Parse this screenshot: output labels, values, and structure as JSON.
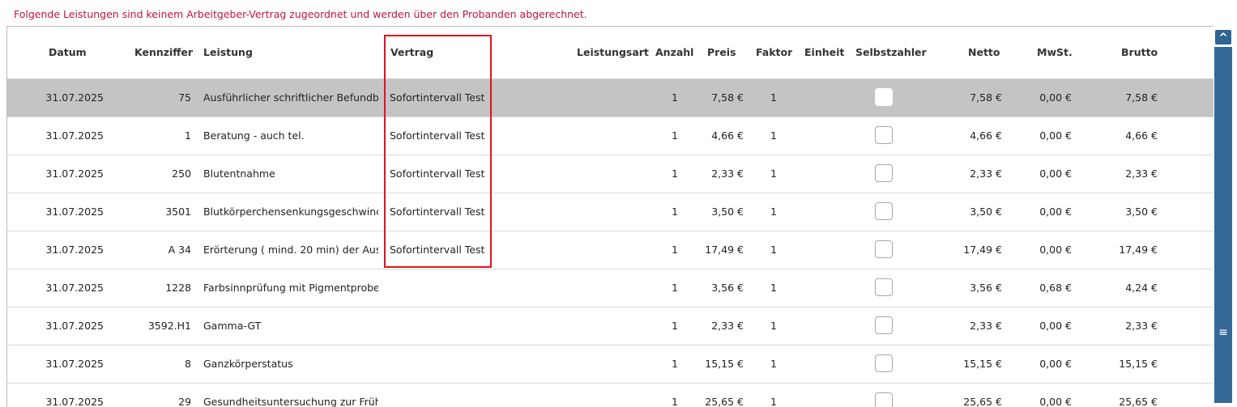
{
  "notice": "Folgende Leistungen sind keinem Arbeitgeber-Vertrag zugeordnet und werden über den Probanden abgerechnet.",
  "headers": {
    "datum": "Datum",
    "kennziffer": "Kennziffer",
    "leistung": "Leistung",
    "vertrag": "Vertrag",
    "leistungsart": "Leistungsart",
    "anzahl": "Anzahl",
    "preis": "Preis",
    "faktor": "Faktor",
    "einheit": "Einheit",
    "selbstzahler": "Selbstzahler",
    "netto": "Netto",
    "mwst": "MwSt.",
    "brutto": "Brutto"
  },
  "rows": [
    {
      "datum": "31.07.2025",
      "kennziffer": "75",
      "leistung": "Ausführlicher schriftlicher Befundbe",
      "vertrag": "Sofortintervall Test",
      "anzahl": "1",
      "preis": "7,58 €",
      "faktor": "1",
      "netto": "7,58 €",
      "mwst": "0,00 €",
      "brutto": "7,58 €",
      "selected": true
    },
    {
      "datum": "31.07.2025",
      "kennziffer": "1",
      "leistung": "Beratung - auch tel.",
      "vertrag": "Sofortintervall Test",
      "anzahl": "1",
      "preis": "4,66 €",
      "faktor": "1",
      "netto": "4,66 €",
      "mwst": "0,00 €",
      "brutto": "4,66 €"
    },
    {
      "datum": "31.07.2025",
      "kennziffer": "250",
      "leistung": "Blutentnahme",
      "vertrag": "Sofortintervall Test",
      "anzahl": "1",
      "preis": "2,33 €",
      "faktor": "1",
      "netto": "2,33 €",
      "mwst": "0,00 €",
      "brutto": "2,33 €"
    },
    {
      "datum": "31.07.2025",
      "kennziffer": "3501",
      "leistung": "Blutkörperchensenkungsgeschwinc",
      "vertrag": "Sofortintervall Test",
      "anzahl": "1",
      "preis": "3,50 €",
      "faktor": "1",
      "netto": "3,50 €",
      "mwst": "0,00 €",
      "brutto": "3,50 €"
    },
    {
      "datum": "31.07.2025",
      "kennziffer": "A 34",
      "leistung": "Erörterung ( mind. 20 min) der Aus",
      "vertrag": "Sofortintervall Test",
      "anzahl": "1",
      "preis": "17,49 €",
      "faktor": "1",
      "netto": "17,49 €",
      "mwst": "0,00 €",
      "brutto": "17,49 €"
    },
    {
      "datum": "31.07.2025",
      "kennziffer": "1228",
      "leistung": "Farbsinnprüfung mit Pigmentprobe",
      "vertrag": "",
      "anzahl": "1",
      "preis": "3,56 €",
      "faktor": "1",
      "netto": "3,56 €",
      "mwst": "0,68 €",
      "brutto": "4,24 €"
    },
    {
      "datum": "31.07.2025",
      "kennziffer": "3592.H1",
      "leistung": "Gamma-GT",
      "vertrag": "",
      "anzahl": "1",
      "preis": "2,33 €",
      "faktor": "1",
      "netto": "2,33 €",
      "mwst": "0,00 €",
      "brutto": "2,33 €"
    },
    {
      "datum": "31.07.2025",
      "kennziffer": "8",
      "leistung": "Ganzkörperstatus",
      "vertrag": "",
      "anzahl": "1",
      "preis": "15,15 €",
      "faktor": "1",
      "netto": "15,15 €",
      "mwst": "0,00 €",
      "brutto": "15,15 €"
    },
    {
      "datum": "31.07.2025",
      "kennziffer": "29",
      "leistung": "Gesundheitsuntersuchung zur Früh",
      "vertrag": "",
      "anzahl": "1",
      "preis": "25,65 €",
      "faktor": "1",
      "netto": "25,65 €",
      "mwst": "0,00 €",
      "brutto": "25,65 €"
    }
  ],
  "scrollbar": {
    "up_glyph": "^",
    "thumb_glyph": "≡"
  }
}
